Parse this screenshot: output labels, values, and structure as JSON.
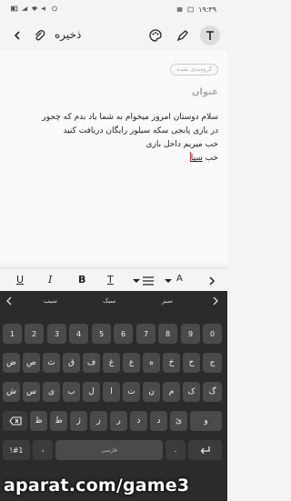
{
  "status_bar": {
    "time": "۱۹:۳۹"
  },
  "toolbar": {
    "save_label": "ذخیره"
  },
  "note": {
    "category_chip": "گروه‌بندی نشده",
    "title_placeholder": "عنوان",
    "lines": [
      "سلام دوستان امروز میخوام به شما یاد بدم که چجور",
      "در بازی پابجی سکه سیلور رایگان دریافت کنید",
      "خب میریم داخل بازی",
      "خب "
    ],
    "last_word": "سیا"
  },
  "format_bar": {
    "underline": "U",
    "italic": "I",
    "bold": "B",
    "text": "T",
    "size": "A"
  },
  "keyboard": {
    "suggestions": [
      "سبب",
      "سبک",
      "سبز"
    ],
    "number_row": [
      "1",
      "2",
      "3",
      "4",
      "5",
      "6",
      "7",
      "8",
      "9",
      "0"
    ],
    "row1": [
      "ض",
      "ص",
      "ث",
      "ق",
      "ف",
      "غ",
      "ع",
      "ه",
      "خ",
      "ح",
      "ج"
    ],
    "row2": [
      "ش",
      "س",
      "ی",
      "ب",
      "ل",
      "ا",
      "ت",
      "ن",
      "م",
      "ک",
      "گ"
    ],
    "row3": [
      "ظ",
      "ط",
      "ژ",
      "ز",
      "ر",
      "ذ",
      "د",
      "ئ",
      "و"
    ],
    "symbols_key": "!#1",
    "comma_key": "،",
    "space_label": "فارسی",
    "period_key": "."
  },
  "watermark": "aparat.com/game3"
}
